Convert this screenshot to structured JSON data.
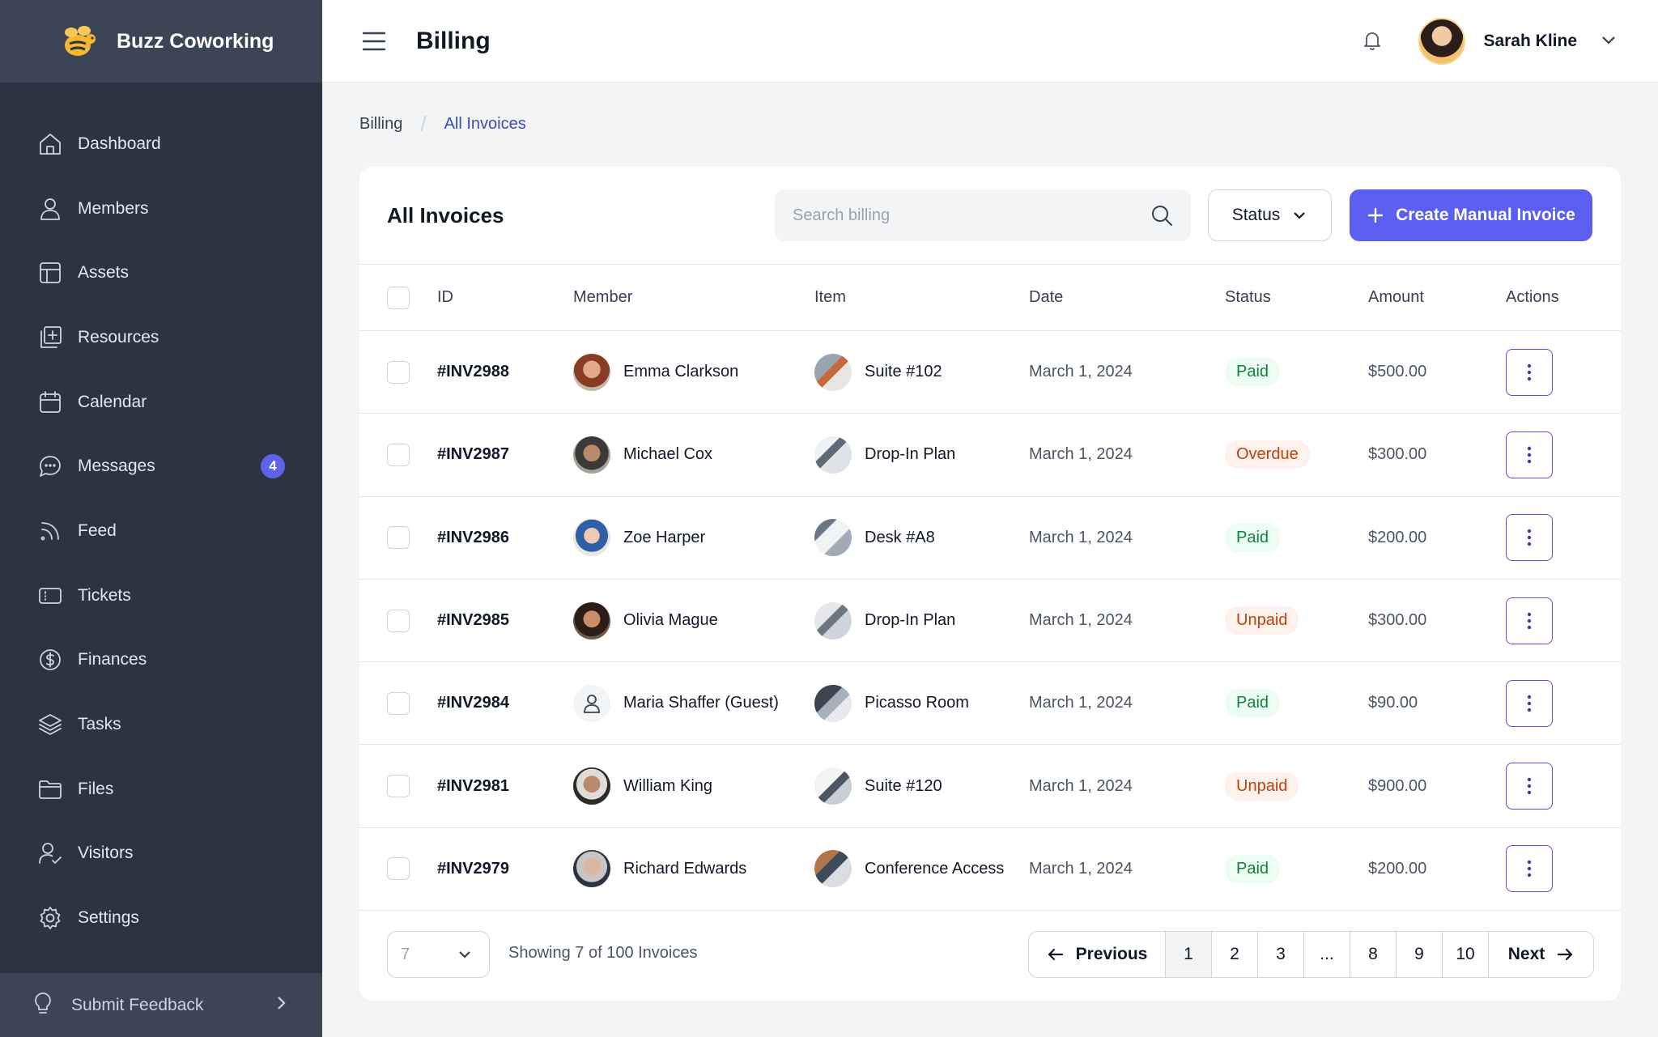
{
  "brand": {
    "name": "Buzz Coworking"
  },
  "sidebar": {
    "items": [
      {
        "label": "Dashboard",
        "icon": "home-icon"
      },
      {
        "label": "Members",
        "icon": "user-icon"
      },
      {
        "label": "Assets",
        "icon": "layout-icon"
      },
      {
        "label": "Resources",
        "icon": "add-resource-icon"
      },
      {
        "label": "Calendar",
        "icon": "calendar-icon"
      },
      {
        "label": "Messages",
        "icon": "chat-icon",
        "badge": "4"
      },
      {
        "label": "Feed",
        "icon": "rss-icon"
      },
      {
        "label": "Tickets",
        "icon": "ticket-icon"
      },
      {
        "label": "Finances",
        "icon": "dollar-icon"
      },
      {
        "label": "Tasks",
        "icon": "layers-icon"
      },
      {
        "label": "Files",
        "icon": "folder-icon"
      },
      {
        "label": "Visitors",
        "icon": "user-check-icon"
      },
      {
        "label": "Settings",
        "icon": "gear-icon"
      }
    ],
    "feedback_label": "Submit Feedback"
  },
  "header": {
    "title": "Billing",
    "user_name": "Sarah Kline"
  },
  "breadcrumb": {
    "parent": "Billing",
    "current": "All Invoices"
  },
  "invoices": {
    "title": "All Invoices",
    "search_placeholder": "Search billing",
    "status_filter_label": "Status",
    "create_button_label": "Create Manual Invoice",
    "columns": [
      "ID",
      "Member",
      "Item",
      "Date",
      "Status",
      "Amount",
      "Actions"
    ],
    "rows": [
      {
        "id": "#INV2988",
        "member": "Emma Clarkson",
        "item": "Suite #102",
        "date": "March 1, 2024",
        "status": "Paid",
        "amount": "$500.00"
      },
      {
        "id": "#INV2987",
        "member": "Michael Cox",
        "item": "Drop-In Plan",
        "date": "March 1, 2024",
        "status": "Overdue",
        "amount": "$300.00"
      },
      {
        "id": "#INV2986",
        "member": "Zoe Harper",
        "item": "Desk #A8",
        "date": "March 1, 2024",
        "status": "Paid",
        "amount": "$200.00"
      },
      {
        "id": "#INV2985",
        "member": "Olivia Mague",
        "item": "Drop-In Plan",
        "date": "March 1, 2024",
        "status": "Unpaid",
        "amount": "$300.00"
      },
      {
        "id": "#INV2984",
        "member": "Maria Shaffer (Guest)",
        "item": "Picasso Room",
        "date": "March 1, 2024",
        "status": "Paid",
        "amount": "$90.00"
      },
      {
        "id": "#INV2981",
        "member": "William King",
        "item": "Suite #120",
        "date": "March 1, 2024",
        "status": "Unpaid",
        "amount": "$900.00"
      },
      {
        "id": "#INV2979",
        "member": "Richard Edwards",
        "item": "Conference Access",
        "date": "March 1, 2024",
        "status": "Paid",
        "amount": "$200.00"
      }
    ]
  },
  "footer": {
    "page_size": "7",
    "showing_text": "Showing 7 of 100 Invoices",
    "previous_label": "Previous",
    "next_label": "Next",
    "pages": [
      "1",
      "2",
      "3",
      "...",
      "8",
      "9",
      "10"
    ],
    "current_page": "1"
  },
  "colors": {
    "sidebar_bg": "#2c3444",
    "accent": "#5a5ff0",
    "paid": "#15803d",
    "unpaid": "#c2410c"
  }
}
